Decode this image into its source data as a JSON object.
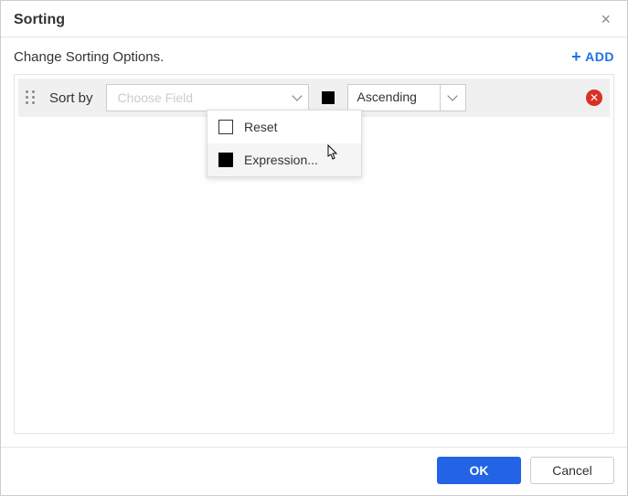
{
  "dialog": {
    "title": "Sorting",
    "description": "Change Sorting Options.",
    "add_label": "ADD"
  },
  "row": {
    "label": "Sort by",
    "field_placeholder": "Choose Field",
    "order_value": "Ascending"
  },
  "dropdown": {
    "options": [
      {
        "label": "Reset",
        "filled": false
      },
      {
        "label": "Expression...",
        "filled": true
      }
    ]
  },
  "footer": {
    "ok": "OK",
    "cancel": "Cancel"
  }
}
